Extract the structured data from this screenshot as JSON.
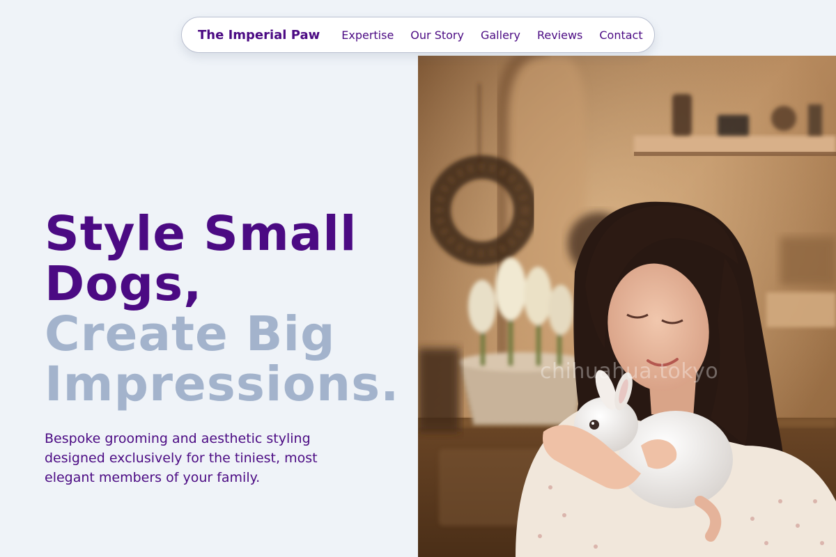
{
  "nav": {
    "brand": "The Imperial Paw",
    "links": [
      {
        "label": "Expertise"
      },
      {
        "label": "Our Story"
      },
      {
        "label": "Gallery"
      },
      {
        "label": "Reviews"
      },
      {
        "label": "Contact"
      }
    ]
  },
  "hero": {
    "headline_line1": "Style Small",
    "headline_line2": "Dogs,",
    "headline_line3": "Create Big",
    "headline_line4": "Impressions.",
    "subtitle": "Bespoke grooming and aesthetic styling designed exclusively for the tiniest, most elegant members of your family."
  },
  "photo": {
    "watermark": "chihuahua.tokyo"
  },
  "colors": {
    "brand_purple": "#4b0a83",
    "headline_slate": "#a3b3cc",
    "page_background": "#eff3f8"
  }
}
